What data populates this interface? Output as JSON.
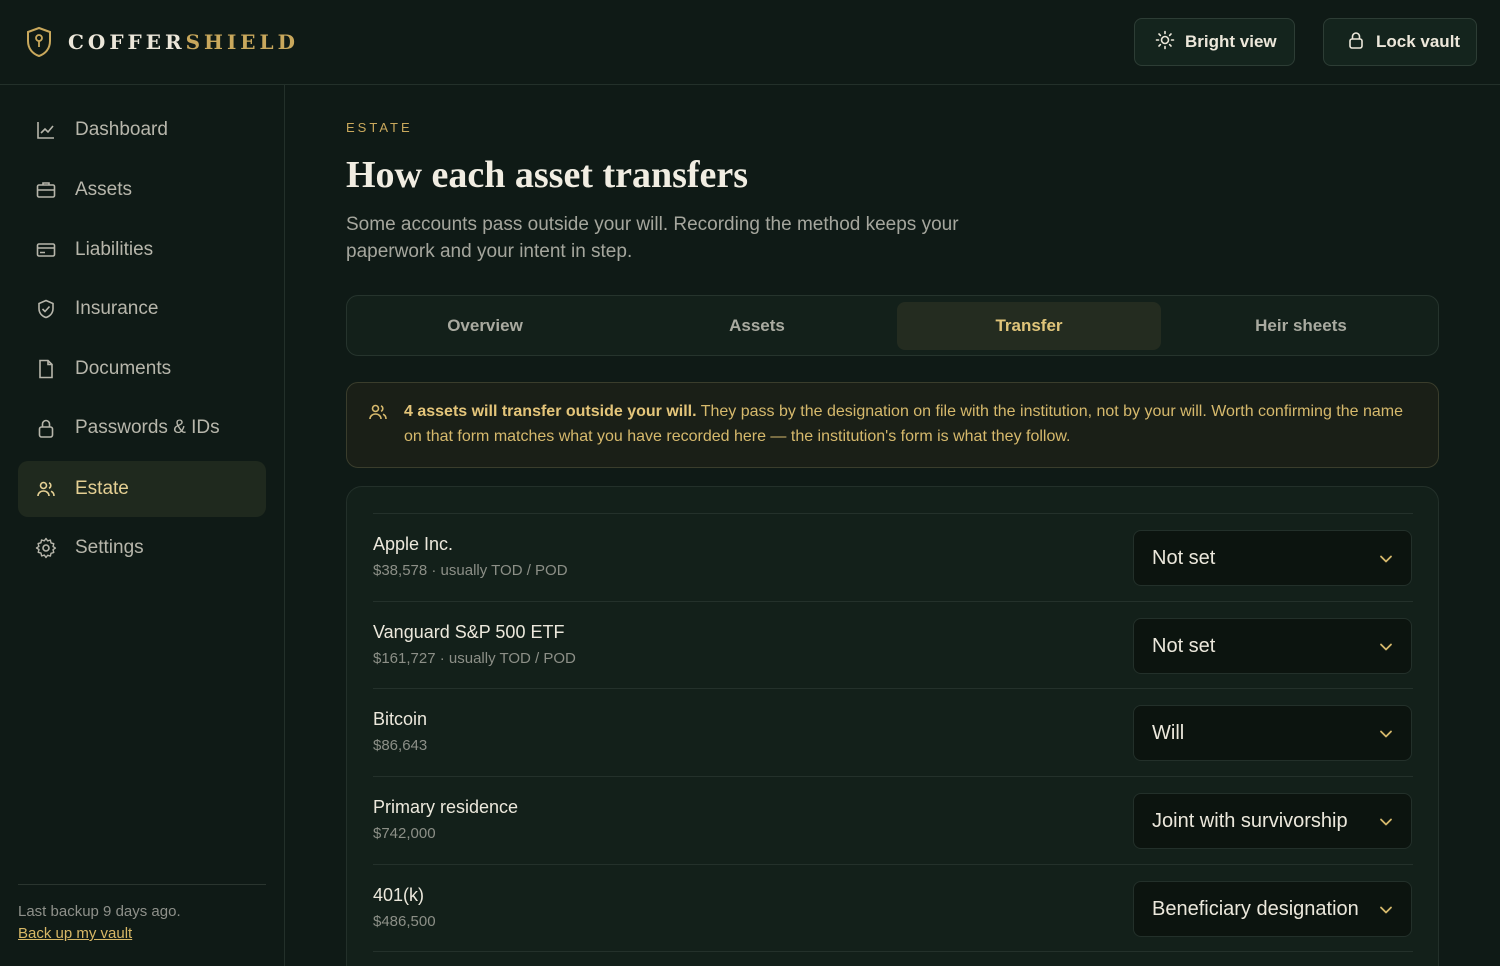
{
  "brand": {
    "name_part1": "COFFER",
    "name_part2": "SHIELD"
  },
  "header": {
    "bright_label": "Bright view",
    "lock_label": "Lock vault"
  },
  "sidebar": {
    "items": [
      {
        "label": "Dashboard",
        "icon": "chart-icon"
      },
      {
        "label": "Assets",
        "icon": "briefcase-icon"
      },
      {
        "label": "Liabilities",
        "icon": "card-icon"
      },
      {
        "label": "Insurance",
        "icon": "shield-icon"
      },
      {
        "label": "Documents",
        "icon": "document-icon"
      },
      {
        "label": "Passwords & IDs",
        "icon": "lock-icon"
      },
      {
        "label": "Estate",
        "icon": "people-icon"
      },
      {
        "label": "Settings",
        "icon": "gear-icon"
      }
    ],
    "active": "Estate",
    "backup_text": "Last backup 9 days ago.",
    "backup_link": "Back up my vault"
  },
  "main": {
    "eyebrow": "ESTATE",
    "title": "How each asset transfers",
    "subtitle": "Some accounts pass outside your will. Recording the method keeps your paperwork and your intent in step.",
    "tabs": [
      {
        "label": "Overview"
      },
      {
        "label": "Assets"
      },
      {
        "label": "Transfer"
      },
      {
        "label": "Heir sheets"
      }
    ],
    "active_tab": "Transfer",
    "notice": {
      "bold": "4 assets will transfer outside your will.",
      "text": " They pass by the designation on file with the institution, not by your will. Worth confirming the name on that form matches what you have recorded here — the institution's form is what they follow."
    },
    "assets": [
      {
        "name": "Apple Inc.",
        "meta": "$38,578 · usually TOD / POD",
        "method": "Not set"
      },
      {
        "name": "Vanguard S&P 500 ETF",
        "meta": "$161,727 · usually TOD / POD",
        "method": "Not set"
      },
      {
        "name": "Bitcoin",
        "meta": "$86,643",
        "method": "Will"
      },
      {
        "name": "Primary residence",
        "meta": "$742,000",
        "method": "Joint with survivorship"
      },
      {
        "name": "401(k)",
        "meta": "$486,500",
        "method": "Beneficiary designation"
      }
    ]
  },
  "colors": {
    "accent": "#c9a85c",
    "background": "#0f1a16",
    "panel": "#13201a"
  }
}
